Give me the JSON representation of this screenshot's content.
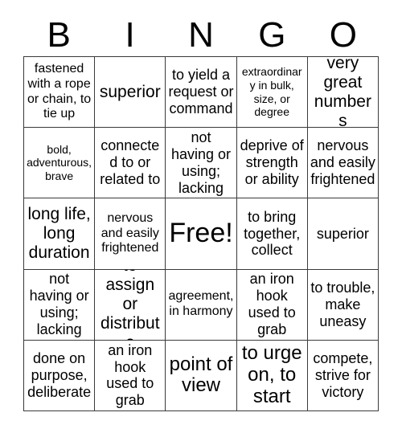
{
  "card": {
    "title": "BINGO",
    "header_letters": [
      "B",
      "I",
      "N",
      "G",
      "O"
    ],
    "free_space_label": "Free!",
    "columns": 5,
    "rows": 5,
    "border_color": "#3a3a3a",
    "background_color": "#ffffff",
    "text_color": "#000000",
    "cells": [
      [
        {
          "text": "fastened with a rope or chain, to tie up",
          "size": "sm",
          "free": false
        },
        {
          "text": "superior",
          "size": "lg",
          "free": false
        },
        {
          "text": "to yield a request or command",
          "size": "md",
          "free": false
        },
        {
          "text": "extraordinary in bulk, size, or degree",
          "size": "xs",
          "free": false
        },
        {
          "text": "very great numbers",
          "size": "lg",
          "free": false
        }
      ],
      [
        {
          "text": "bold, adventurous, brave",
          "size": "xs",
          "free": false
        },
        {
          "text": "connected to or related to",
          "size": "md",
          "free": false
        },
        {
          "text": "not having or using; lacking",
          "size": "md",
          "free": false
        },
        {
          "text": "deprive of strength or ability",
          "size": "md",
          "free": false
        },
        {
          "text": "nervous and easily frightened",
          "size": "md",
          "free": false
        }
      ],
      [
        {
          "text": "long life, long duration",
          "size": "lg",
          "free": false
        },
        {
          "text": "nervous and easily frightened",
          "size": "sm",
          "free": false
        },
        {
          "text": "Free!",
          "size": "xxl",
          "free": true
        },
        {
          "text": "to bring together, collect",
          "size": "md",
          "free": false
        },
        {
          "text": "superior",
          "size": "md",
          "free": false
        }
      ],
      [
        {
          "text": "not having or using; lacking",
          "size": "md",
          "free": false
        },
        {
          "text": "to assign or distribute",
          "size": "lg",
          "free": false
        },
        {
          "text": "agreement, in harmony",
          "size": "sm",
          "free": false
        },
        {
          "text": "an iron hook used to grab",
          "size": "md",
          "free": false
        },
        {
          "text": "to trouble, make uneasy",
          "size": "md",
          "free": false
        }
      ],
      [
        {
          "text": "done on purpose, deliberate",
          "size": "md",
          "free": false
        },
        {
          "text": "an iron hook used to grab",
          "size": "md",
          "free": false
        },
        {
          "text": "point of view",
          "size": "xl",
          "free": false
        },
        {
          "text": "to urge on, to start",
          "size": "xl",
          "free": false
        },
        {
          "text": "compete, strive for victory",
          "size": "md",
          "free": false
        }
      ]
    ]
  }
}
